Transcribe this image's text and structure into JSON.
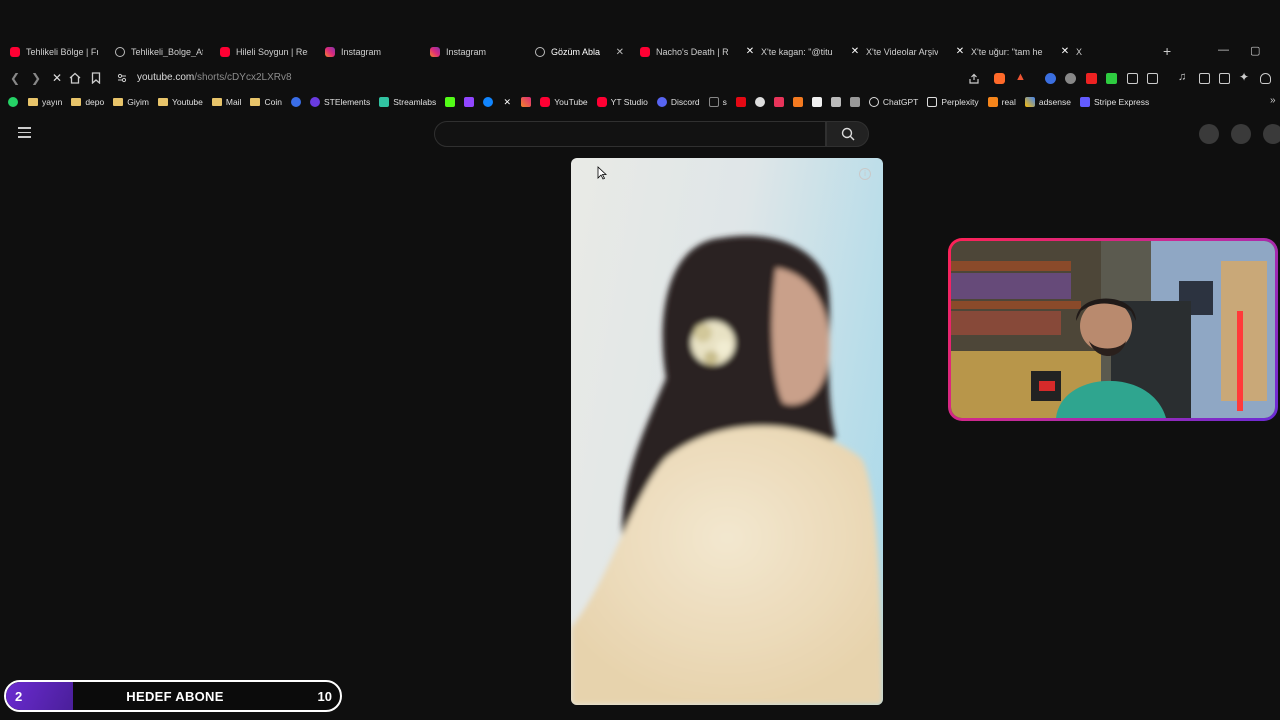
{
  "browser": {
    "tabs": [
      {
        "label": "Tehlikeli Bölge | Fra",
        "icon": "youtube-icon",
        "active": false
      },
      {
        "label": "Tehlikeli_Bolge_Afis",
        "icon": "globe-icon",
        "active": false
      },
      {
        "label": "Hileli Soygun | Resm",
        "icon": "youtube-icon",
        "active": false
      },
      {
        "label": "Instagram",
        "icon": "instagram-icon",
        "active": false
      },
      {
        "label": "Instagram",
        "icon": "instagram-icon",
        "active": false
      },
      {
        "label": "Gözüm Abla",
        "icon": "globe-icon",
        "active": true
      },
      {
        "label": "Nacho's Death | Ro",
        "icon": "youtube-icon",
        "active": false
      },
      {
        "label": "X'te kagan: \"@tituq",
        "icon": "x-icon",
        "active": false
      },
      {
        "label": "X'te Videolar Arşivi",
        "icon": "x-icon",
        "active": false
      },
      {
        "label": "X'te uğur: \"tam her",
        "icon": "x-icon",
        "active": false
      },
      {
        "label": "X",
        "icon": "x-icon",
        "active": false
      }
    ],
    "new_tab": "+",
    "minimize": "—",
    "maximize": "▢",
    "url_host": "youtube.com",
    "url_path": "/shorts/cDYcx2LXRv8"
  },
  "bookmarks": [
    {
      "label": "yayın",
      "icon": "folder-icon"
    },
    {
      "label": "depo",
      "icon": "folder-icon"
    },
    {
      "label": "Giyim",
      "icon": "folder-icon"
    },
    {
      "label": "Youtube",
      "icon": "folder-icon"
    },
    {
      "label": "Mail",
      "icon": "folder-icon"
    },
    {
      "label": "Coin",
      "icon": "folder-icon"
    },
    {
      "label": "STElements",
      "icon": "stelements-icon"
    },
    {
      "label": "Streamlabs",
      "icon": "streamlabs-icon"
    },
    {
      "label": "YouTube",
      "icon": "youtube-icon"
    },
    {
      "label": "YT Studio",
      "icon": "youtube-icon"
    },
    {
      "label": "Discord",
      "icon": "discord-icon"
    },
    {
      "label": "s",
      "icon": "tiktok-icon"
    },
    {
      "label": "ChatGPT",
      "icon": "chatgpt-icon"
    },
    {
      "label": "Perplexity",
      "icon": "perplexity-icon"
    },
    {
      "label": "real",
      "icon": "fox-icon"
    },
    {
      "label": "adsense",
      "icon": "adsense-icon"
    },
    {
      "label": "Stripe Express",
      "icon": "stripe-icon"
    }
  ],
  "youtube": {
    "search_placeholder": ""
  },
  "goal": {
    "current": "2",
    "title": "HEDEF ABONE",
    "target": "10",
    "progress_fraction": 0.2
  },
  "colors": {
    "accent_purple": "#6b2bd1",
    "youtube_red": "#ff0033",
    "webcam_border_start": "#ff2255",
    "webcam_border_end": "#6a2bd6"
  }
}
